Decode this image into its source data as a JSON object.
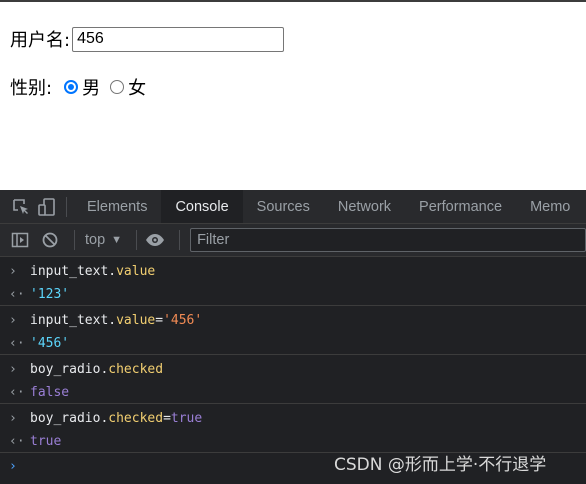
{
  "form": {
    "username_label": "用户名:",
    "username_value": "456",
    "gender_label": "性别:",
    "options": [
      {
        "label": "男",
        "checked": true
      },
      {
        "label": "女",
        "checked": false
      }
    ]
  },
  "devtools": {
    "tabs": [
      "Elements",
      "Console",
      "Sources",
      "Network",
      "Performance",
      "Memo"
    ],
    "active_tab": "Console",
    "context": "top",
    "filter_placeholder": "Filter",
    "entries": [
      {
        "input_obj": "input_text.",
        "input_prop": "value",
        "input_op": "",
        "input_val": "",
        "result": "'123'"
      },
      {
        "input_obj": "input_text.",
        "input_prop": "value",
        "input_op": "=",
        "input_val": "'456'",
        "result": "'456'"
      },
      {
        "input_obj": "boy_radio.",
        "input_prop": "checked",
        "input_op": "",
        "input_val": "",
        "result": "false"
      },
      {
        "input_obj": "boy_radio.",
        "input_prop": "checked",
        "input_op": "=",
        "input_val": "true",
        "result": "true"
      }
    ],
    "icons": [
      "inspect-icon",
      "device-toolbar-icon",
      "sidebar-toggle-icon",
      "clear-console-icon",
      "eye-icon"
    ]
  },
  "watermark": "CSDN @形而上学·不行退学",
  "colors": {
    "accent": "#0075ff",
    "devtools_bg": "#202124",
    "prompt": "#4da3ff"
  }
}
